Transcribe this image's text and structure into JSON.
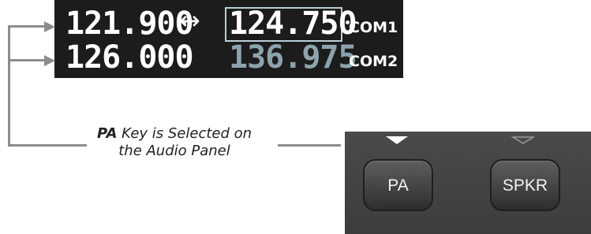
{
  "com1": {
    "standby": "121.900",
    "active": "124.750",
    "label": "COM1",
    "swap_icon": "↔"
  },
  "com2": {
    "standby": "126.000",
    "active": "136.975",
    "label": "COM2"
  },
  "callout": {
    "bold": "PA",
    "text_line1": " Key is Selected on",
    "text_line2": "the Audio Panel"
  },
  "audio_panel": {
    "pa_label": "PA",
    "spkr_label": "SPKR",
    "pa_indicator": "active",
    "spkr_indicator": "inactive"
  },
  "colors": {
    "display_background": "#1c1c1c",
    "active_frequency": "#ffffff",
    "standby_inactive_frequency": "#8ba3ad",
    "callout_line": "#8c8c8c",
    "panel_background": "#444444"
  }
}
